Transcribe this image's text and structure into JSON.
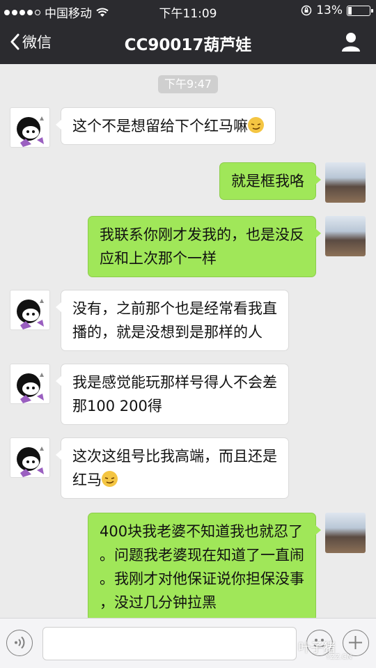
{
  "status_bar": {
    "carrier": "中国移动",
    "time": "下午11:09",
    "battery": "13%"
  },
  "nav": {
    "back_label": "微信",
    "title": "CC90017葫芦娃"
  },
  "chat": {
    "time_separator": "下午9:47",
    "messages": [
      {
        "side": "left",
        "lines": [
          "这个不是想留给下个红马嘛"
        ],
        "emoji": true
      },
      {
        "side": "right",
        "lines": [
          "就是框我咯"
        ]
      },
      {
        "side": "right",
        "lines": [
          "我联系你刚才发我的，也是没反",
          "应和上次那个一样"
        ]
      },
      {
        "side": "left",
        "lines": [
          "没有，之前那个也是经常看我直",
          "播的，就是没想到是那样的人"
        ]
      },
      {
        "side": "left",
        "lines": [
          "我是感觉能玩那样号得人不会差",
          "那100 200得"
        ]
      },
      {
        "side": "left",
        "lines": [
          "这次这组号比我高端，而且还是",
          "红马"
        ],
        "emoji": true
      },
      {
        "side": "right",
        "lines": [
          "400块我老婆不知道我也就忍了",
          "。问题我老婆现在知道了一直闹",
          "。我刚才对他保证说你担保没事",
          "，没过几分钟拉黑"
        ]
      }
    ]
  },
  "watermark": {
    "text": "叶子猪",
    "url": "YZZ.CN"
  },
  "colors": {
    "nav_bg": "#2b2b2f",
    "chat_bg": "#ebebeb",
    "outgoing_bubble": "#a0e759",
    "incoming_bubble": "#ffffff"
  }
}
